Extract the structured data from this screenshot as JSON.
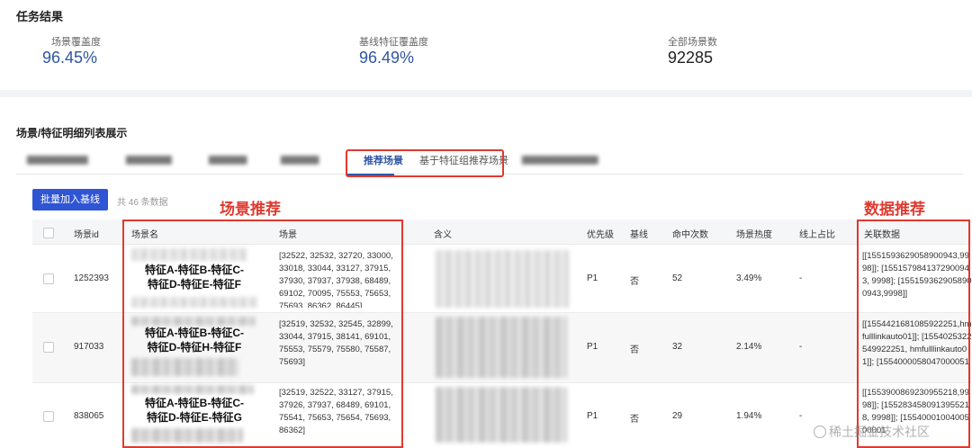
{
  "summary": {
    "title": "任务结果",
    "metrics": [
      {
        "label": "场景覆盖度",
        "value": "96.45%"
      },
      {
        "label": "基线特征覆盖度",
        "value": "96.49%"
      },
      {
        "label": "全部场景数",
        "value": "92285"
      }
    ]
  },
  "list": {
    "title": "场景/特征明细列表展示",
    "tabs": [
      {
        "label": "",
        "blurred": true
      },
      {
        "label": "",
        "blurred": true
      },
      {
        "label": "",
        "blurred": true
      },
      {
        "label": "",
        "blurred": true
      },
      {
        "label": "推荐场景",
        "active": true
      },
      {
        "label": "基于特征组推荐场景"
      },
      {
        "label": "",
        "blurred": true
      }
    ],
    "batch_button": "批量加入基线",
    "count": "共 46 条数据"
  },
  "annotations": {
    "scene_recommend": "场景推荐",
    "data_recommend": "数据推荐"
  },
  "table": {
    "headers": [
      "场景id",
      "场景名",
      "场景",
      "含义",
      "优先级",
      "基线",
      "命中次数",
      "场景热度",
      "线上占比",
      "关联数据"
    ],
    "rows": [
      {
        "id": "1252393",
        "name_lines": [
          "特征A-特征B-特征C-",
          "特征D-特征E-特征F"
        ],
        "scene": "[32522, 32532, 32720, 33000, 33018, 33044, 33127, 37915, 37930, 37937, 37938, 68489, 69102, 70095, 75553, 75653, 75693, 86362, 86445]",
        "priority": "P1",
        "baseline": "否",
        "hits": "52",
        "heat": "3.49%",
        "online": "-",
        "assoc": "[[1551593629058900943,9998]]; [1551579841372900943, 9998]; [1551593629058900943,9998]]"
      },
      {
        "id": "917033",
        "name_lines": [
          "特征A-特征B-特征C-",
          "特征D-特征H-特征F"
        ],
        "scene": "[32519, 32532, 32545, 32899, 33044, 37915, 38141, 69101, 75553, 75579, 75580, 75587, 75693]",
        "priority": "P1",
        "baseline": "否",
        "hits": "32",
        "heat": "2.14%",
        "online": "-",
        "assoc": "[[1554421681085922251,hmfulllinkauto01]]; [1554025322549922251, hmfulllinkauto01]]; [1554000058047000051"
      },
      {
        "id": "838065",
        "name_lines": [
          "特征A-特征B-特征C-",
          "特征D-特征E-特征G"
        ],
        "scene": "[32519, 32522, 33127, 37915, 37926, 37937, 68489, 69101, 75541, 75653, 75654, 75693, 86362]",
        "priority": "P1",
        "baseline": "否",
        "hits": "29",
        "heat": "1.94%",
        "online": "-",
        "assoc": "[[1553900869230955218,9998]]; [1552834580913955218, 9998]]; [1554000100400500001"
      }
    ]
  },
  "watermark": "稀土掘金技术社区",
  "colors": {
    "accent": "#2f55a4",
    "button": "#2f55d4",
    "annotation_red": "#e03a2f"
  }
}
